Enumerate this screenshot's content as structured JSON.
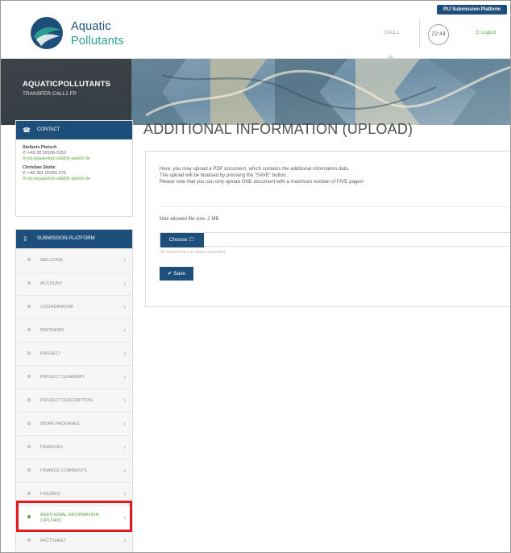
{
  "header": {
    "logo_line1": "Aquatic",
    "logo_line2": "Pollutants",
    "portal_badge": "PtJ Submission Platform",
    "call_label": "CALL1",
    "timer": "22:44",
    "logout": "Logout",
    "logout_icon": "power-icon"
  },
  "banner": {
    "title": "AQUATICPOLLUTANTS",
    "subtitle": "TRANSFER CALL1 FP"
  },
  "contact": {
    "heading": "CONTACT",
    "people": [
      {
        "name": "Stefanie Pietsch",
        "phone": "+49 30 20199-3152",
        "email": "ptj-aquapollut.call@fz-juelich.de"
      },
      {
        "name": "Christian Stolte",
        "phone": "+49 381 20356-275",
        "email": "ptj-aquapollut.call@fz-juelich.de"
      }
    ]
  },
  "nav": {
    "heading": "SUBMISSION PLATFORM",
    "items": [
      {
        "label": "WELCOME"
      },
      {
        "label": "ACCOUNT"
      },
      {
        "label": "COORDINATOR"
      },
      {
        "label": "PARTNERS"
      },
      {
        "label": "PROJECT"
      },
      {
        "label": "PROJECT SUMMARY"
      },
      {
        "label": "PROJECT DESCRIPTION"
      },
      {
        "label": "WORK PACKAGES"
      },
      {
        "label": "FINANCES"
      },
      {
        "label": "FINANCE COMMENTS"
      },
      {
        "label": "FIGURES"
      },
      {
        "label": "ADDITIONAL INFORMATION (UPLOAD)",
        "active": true
      },
      {
        "label": "FACTSHEET"
      }
    ]
  },
  "main": {
    "title": "ADDITIONAL INFORMATION (UPLOAD)",
    "info_line1": "Here, you may upload a PDF document, which contains the additional information data.",
    "info_line2": "The upload will be finalised by pressing the \"SAVE\" button.",
    "info_line3": "Please note that you can only upload ONE document with a maximum number of FIVE pages!",
    "max_size": "Max allowed file size: 2 MB",
    "choose_label": "Choose 🗁",
    "file_value": "",
    "no_document": "No document has been uploaded.",
    "save_label": "✔ Save"
  },
  "colors": {
    "brand_blue": "#1d4f7a",
    "accent_green": "#5aaa3e",
    "highlight_red": "#e3191f"
  }
}
